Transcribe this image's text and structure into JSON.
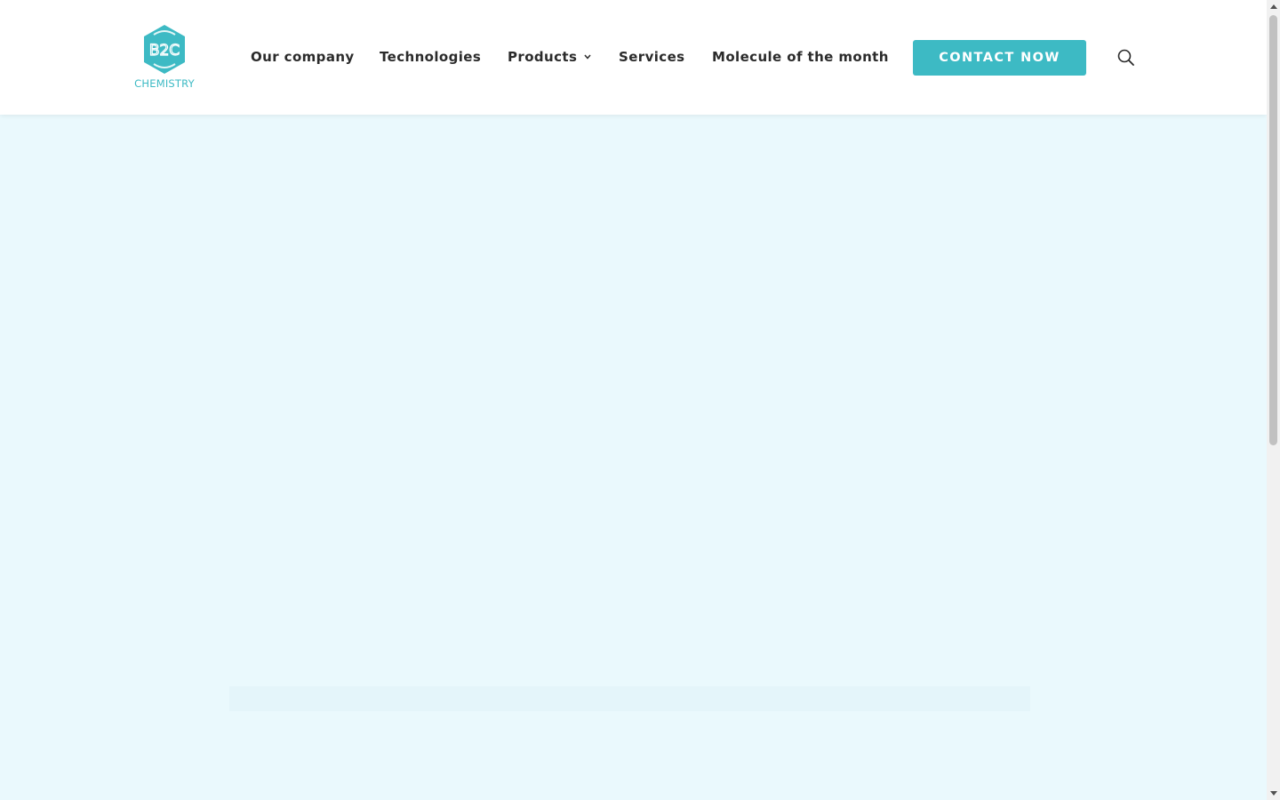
{
  "colors": {
    "accent": "#3dbac4",
    "nav_text": "#2b2b2b",
    "hero_background": "#eaf9fd",
    "hero_band": "#e4f5fa",
    "header_background": "#ffffff"
  },
  "header": {
    "logo": {
      "mark_text": "B2C",
      "caption": "CHEMISTRY",
      "icon": "hexagon-logo-icon"
    },
    "nav": [
      {
        "label": "Our company"
      },
      {
        "label": "Technologies"
      },
      {
        "label": "Products",
        "has_dropdown": true,
        "dropdown_icon": "chevron-down-icon"
      },
      {
        "label": "Services"
      },
      {
        "label": "Molecule of the month"
      }
    ],
    "cta_label": "CONTACT NOW",
    "search_icon": "search-icon"
  },
  "scrollbar": {
    "up_icon": "arrow-up-icon",
    "down_icon": "arrow-down-icon"
  }
}
